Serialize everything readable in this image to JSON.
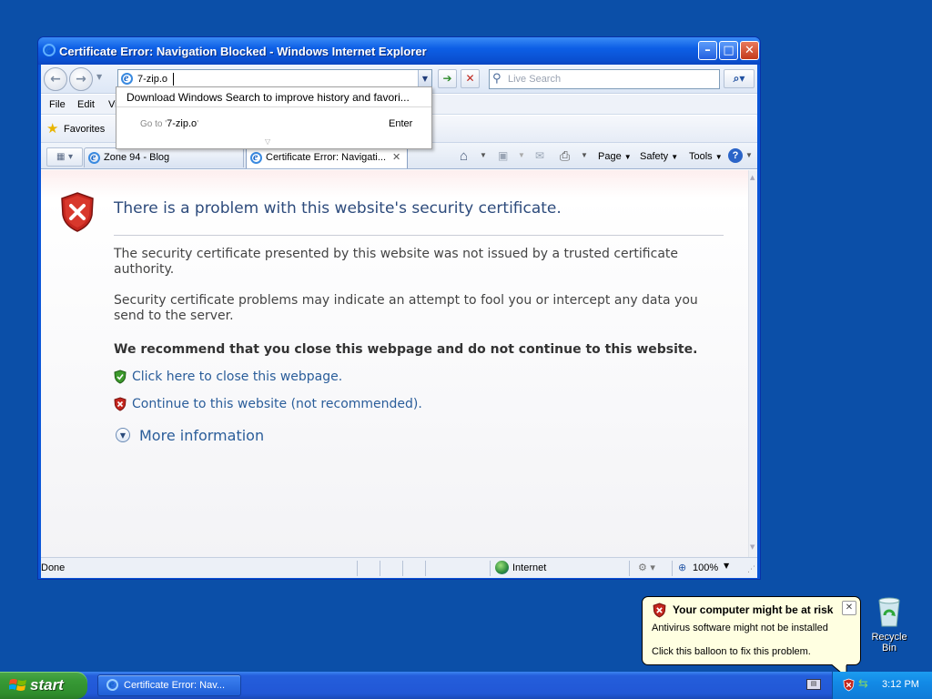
{
  "window": {
    "title": "Certificate Error: Navigation Blocked - Windows Internet Explorer",
    "minimize": "–",
    "maximize": "□",
    "close": "✕"
  },
  "address_bar": {
    "value": "7-zip.o",
    "search_placeholder": "Live Search"
  },
  "address_dropdown": {
    "suggestion": "Download Windows Search to improve history and favori...",
    "goto_prefix": "Go to '",
    "goto_value": "7-zip.o",
    "goto_suffix": "'",
    "shortcut": "Enter"
  },
  "menu": {
    "items": [
      "File",
      "Edit",
      "Vi"
    ]
  },
  "favorites": {
    "label": "Favorites"
  },
  "tabs": [
    {
      "label": "Zone 94 - Blog"
    },
    {
      "label": "Certificate Error: Navigati..."
    }
  ],
  "command_bar": {
    "page": "Page",
    "safety": "Safety",
    "tools": "Tools"
  },
  "page": {
    "title": "There is a problem with this website's security certificate.",
    "para1": "The security certificate presented by this website was not issued by a trusted certificate authority.",
    "para2": "Security certificate problems may indicate an attempt to fool you or intercept any data you send to the server.",
    "recommend": "We recommend that you close this webpage and do not continue to this website.",
    "close_link": "Click here to close this webpage.",
    "continue_link": "Continue to this website (not recommended).",
    "more_info": "More information"
  },
  "status_bar": {
    "text": "Done",
    "zone": "Internet",
    "zoom": "100%"
  },
  "taskbar": {
    "start": "start",
    "item": "Certificate Error: Nav...",
    "clock": "3:12 PM"
  },
  "balloon": {
    "title": "Your computer might be at risk",
    "line1": "Antivirus software might not be installed",
    "line2": "Click this balloon to fix this problem."
  },
  "desktop": {
    "recycle_bin": "Recycle Bin"
  },
  "colors": {
    "desktop": "#0b4fa8",
    "title_link": "#2d4b7c",
    "link": "#2a5d9a",
    "shield_red": "#c4261e",
    "shield_green": "#3d9a2c"
  }
}
